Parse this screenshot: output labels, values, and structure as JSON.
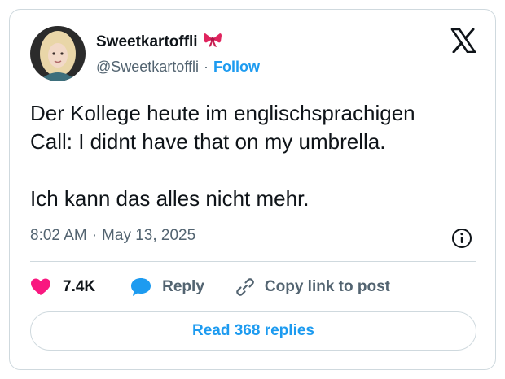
{
  "author": {
    "display_name": "Sweetkartoffli",
    "handle": "@Sweetkartoffli",
    "separator": "·",
    "follow_label": "Follow",
    "badge_emoji": "ribbon-bow"
  },
  "tweet": {
    "lines": [
      "Der Kollege heute im englischsprachigen",
      "Call: I didnt have that on my umbrella.",
      "",
      "Ich kann das alles nicht mehr."
    ],
    "time": "8:02 AM",
    "date_separator": "·",
    "date": "May 13, 2025"
  },
  "actions": {
    "like_count": "7.4K",
    "reply_label": "Reply",
    "copy_label": "Copy link to post"
  },
  "read_replies_label": "Read 368 replies",
  "colors": {
    "accent": "#1d9bf0",
    "like": "#f91880",
    "text": "#0f1419",
    "muted": "#536471",
    "border": "#cfd9de"
  },
  "icons": [
    "x-logo-icon",
    "info-icon",
    "heart-icon",
    "reply-bubble-icon",
    "link-icon",
    "bow-icon"
  ]
}
